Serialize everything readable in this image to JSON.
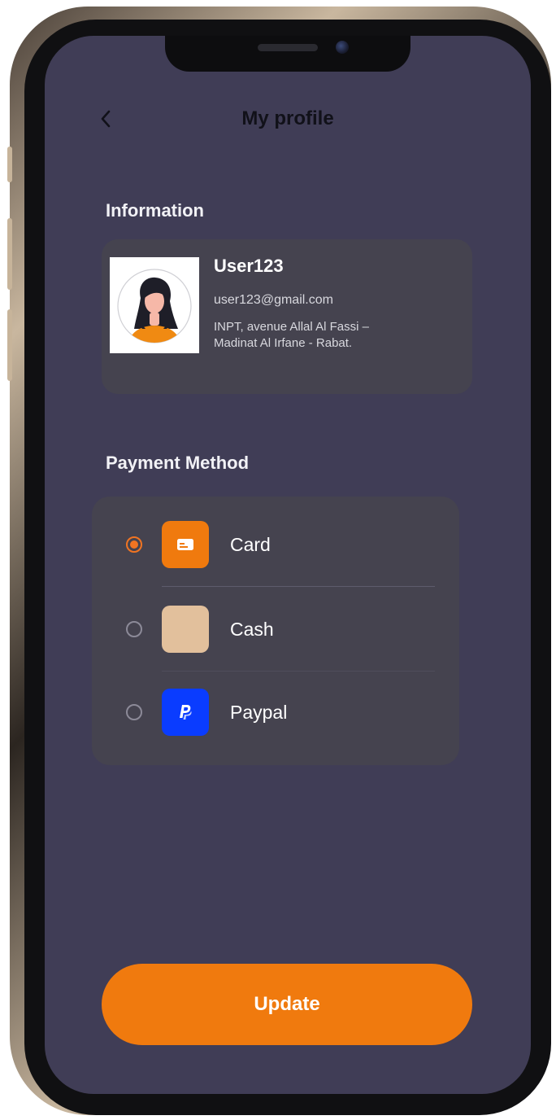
{
  "header": {
    "title": "My profile",
    "back_icon": "chevron-left-icon"
  },
  "information": {
    "section_title": "Information",
    "user": {
      "name": "User123",
      "email": "user123@gmail.com",
      "address": "INPT, avenue Allal Al Fassi – Madinat Al Irfane - Rabat."
    }
  },
  "payment": {
    "section_title": "Payment Method",
    "options": [
      {
        "label": "Card",
        "icon": "card-icon",
        "icon_color": "#f07a0e",
        "selected": true
      },
      {
        "label": "Cash",
        "icon": "cash-icon",
        "icon_color": "#e2c09c",
        "selected": false
      },
      {
        "label": "Paypal",
        "icon": "paypal-icon",
        "icon_color": "#0a3cff",
        "selected": false
      }
    ]
  },
  "actions": {
    "update_label": "Update"
  },
  "colors": {
    "background": "#403d56",
    "card": "#45434f",
    "accent": "#f07a0e"
  }
}
